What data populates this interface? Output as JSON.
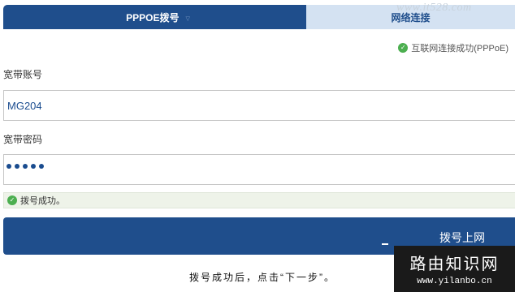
{
  "tabs": [
    {
      "label": "PPPOE拨号",
      "active": true
    },
    {
      "label": "网络连接",
      "active": false
    }
  ],
  "connection_status": "互联网连接成功(PPPoE)",
  "account": {
    "label": "宽带账号",
    "value": "MG204"
  },
  "password": {
    "label": "宽带密码",
    "masked_length": 5
  },
  "dial_result": "拨号成功。",
  "dial_button_label": "拨号上网",
  "hint": "拨号成功后，点击“下一步”。",
  "watermark": {
    "top_text": "www.it528.com",
    "brand": "路由知识网",
    "url": "www.yilanbo.cn"
  },
  "colors": {
    "primary": "#1f4e8c",
    "tab_inactive": "#d4e2f2",
    "success": "#4caf50"
  }
}
